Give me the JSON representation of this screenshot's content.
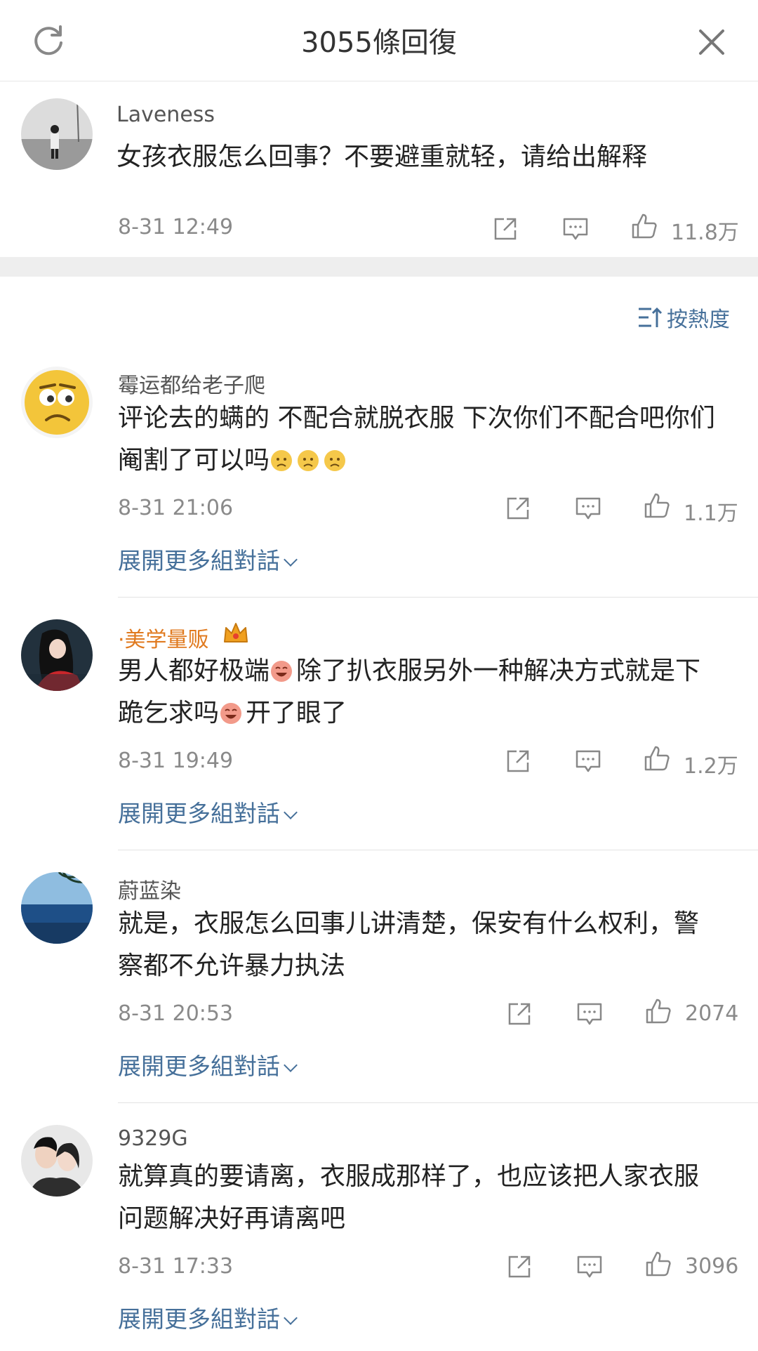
{
  "header": {
    "title": "3055條回復",
    "refresh_icon": "refresh-icon",
    "close_icon": "close-icon"
  },
  "main_comment": {
    "username": "Laveness",
    "text": "女孩衣服怎么回事？不要避重就轻，请给出解释",
    "time": "8-31 12:49",
    "likes": "11.8万"
  },
  "sort": {
    "label": "按熱度"
  },
  "replies": [
    {
      "username": "霉运都给老子爬",
      "line1": "评论去的螨的 不配合就脱衣服 下次你们不配合吧你们",
      "line2": "阉割了可以吗",
      "time": "8-31 21:06",
      "likes": "1.1万",
      "expand": "展開更多組對話"
    },
    {
      "username": "·美学量贩",
      "line1a": "男人都好极端",
      "line1b": "除了扒衣服另外一种解决方式就是下",
      "line2a": "跪乞求吗",
      "line2b": "开了眼了",
      "time": "8-31 19:49",
      "likes": "1.2万",
      "expand": "展開更多組對話"
    },
    {
      "username": "蔚蓝染",
      "line1": "就是，衣服怎么回事儿讲清楚，保安有什么权利，警",
      "line2": "察都不允许暴力执法",
      "time": "8-31 20:53",
      "likes": "2074",
      "expand": "展開更多組對話"
    },
    {
      "username": "9329G",
      "line1": "就算真的要请离，衣服成那样了，也应该把人家衣服",
      "line2": "问题解决好再请离吧",
      "time": "8-31 17:33",
      "likes": "3096",
      "expand": "展開更多組對話"
    }
  ],
  "colors": {
    "link": "#46709a",
    "meta": "#8a8a8a",
    "username_vip": "#e07a1f"
  }
}
